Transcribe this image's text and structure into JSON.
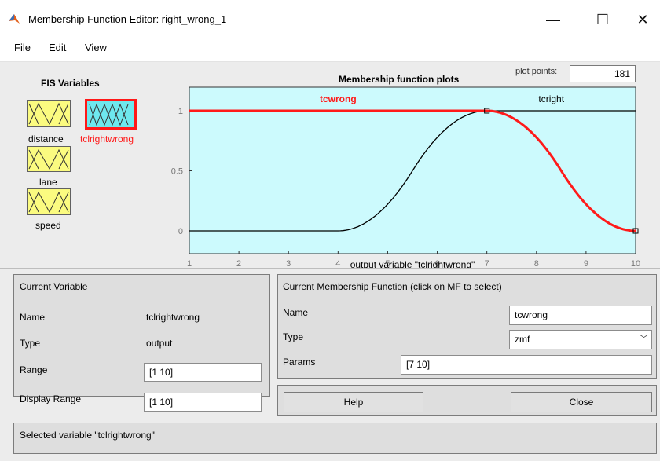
{
  "window": {
    "title": "Membership Function Editor: right_wrong_1",
    "minimize_glyph": "—",
    "maximize_glyph": "☐",
    "close_glyph": "✕"
  },
  "menubar": {
    "items": [
      "File",
      "Edit",
      "View"
    ]
  },
  "fis_variables": {
    "title": "FIS Variables",
    "inputs": [
      "distance",
      "lane",
      "speed"
    ],
    "output": "tclrightwrong",
    "selected": "tclrightwrong"
  },
  "plot": {
    "title": "Membership function plots",
    "plot_points_label": "plot points:",
    "plot_points_value": "181",
    "xlabel": "output variable \"tclrightwrong\""
  },
  "chart_data": {
    "type": "line",
    "title": "Membership function plots",
    "xlabel": "output variable \"tclrightwrong\"",
    "ylabel": "",
    "xlim": [
      1,
      10
    ],
    "ylim": [
      0,
      1.1
    ],
    "x_ticks": [
      "1",
      "2",
      "3",
      "4",
      "5",
      "6",
      "7",
      "8",
      "9",
      "10"
    ],
    "y_ticks": [
      "0",
      "0.5",
      "1"
    ],
    "background": "#ccfafd",
    "series": [
      {
        "name": "tcwrong",
        "mf_type": "zmf",
        "params": [
          7,
          10
        ],
        "color": "#ff1a1a",
        "selected": true,
        "x": [
          1,
          7,
          7.5,
          8,
          8.5,
          9,
          9.5,
          10
        ],
        "y": [
          1,
          1,
          0.944,
          0.778,
          0.5,
          0.222,
          0.056,
          0
        ]
      },
      {
        "name": "tcright",
        "mf_type": "smf",
        "params": [
          4,
          7
        ],
        "color": "#000000",
        "selected": false,
        "x": [
          1,
          4,
          4.5,
          5,
          5.5,
          6,
          6.5,
          7,
          10
        ],
        "y": [
          0,
          0,
          0.056,
          0.222,
          0.5,
          0.778,
          0.944,
          1,
          1
        ]
      }
    ]
  },
  "current_variable": {
    "header": "Current Variable",
    "name_label": "Name",
    "name_value": "tclrightwrong",
    "type_label": "Type",
    "type_value": "output",
    "range_label": "Range",
    "range_value": "[1 10]",
    "display_range_label": "Display Range",
    "display_range_value": "[1 10]"
  },
  "current_mf": {
    "header": "Current Membership Function (click on MF to select)",
    "name_label": "Name",
    "name_value": "tcwrong",
    "type_label": "Type",
    "type_value": "zmf",
    "params_label": "Params",
    "params_value": "[7 10]"
  },
  "buttons": {
    "help": "Help",
    "close": "Close"
  },
  "status": "Selected variable \"tclrightwrong\""
}
